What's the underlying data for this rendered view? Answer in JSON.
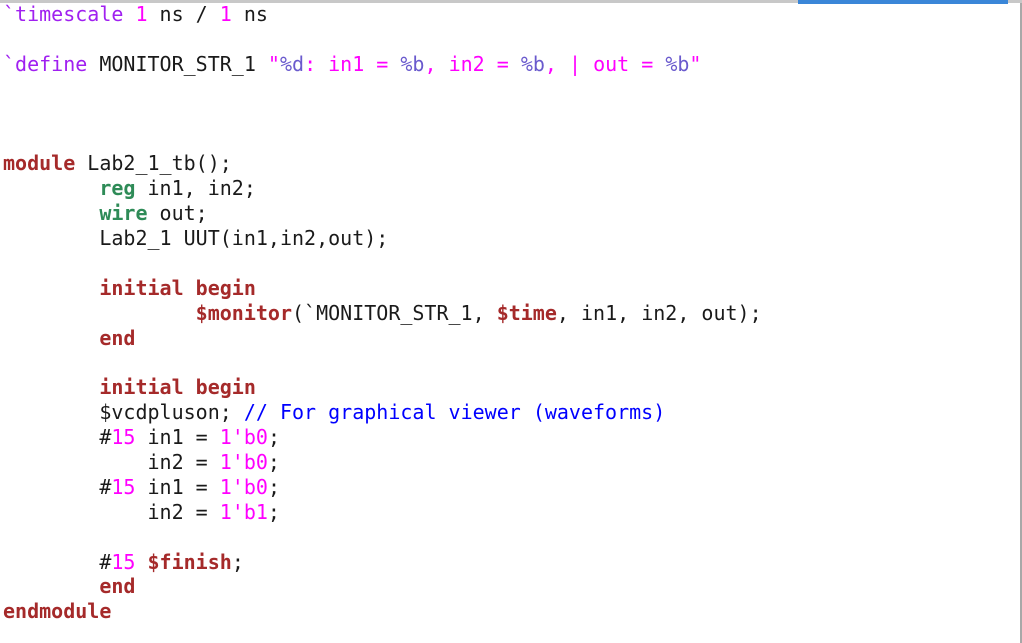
{
  "editor": {
    "language": "verilog",
    "lines": [
      [
        {
          "t": "`timescale",
          "c": "dir"
        },
        {
          "t": " ",
          "c": "plain"
        },
        {
          "t": "1",
          "c": "num"
        },
        {
          "t": " ns / ",
          "c": "plain"
        },
        {
          "t": "1",
          "c": "num"
        },
        {
          "t": " ns",
          "c": "plain"
        }
      ],
      [],
      [
        {
          "t": "`define",
          "c": "dir"
        },
        {
          "t": " MONITOR_STR_1 ",
          "c": "plain"
        },
        {
          "t": "\"",
          "c": "str"
        },
        {
          "t": "%d",
          "c": "fmt"
        },
        {
          "t": ": in1 = ",
          "c": "str"
        },
        {
          "t": "%b",
          "c": "fmt"
        },
        {
          "t": ", in2 = ",
          "c": "str"
        },
        {
          "t": "%b",
          "c": "fmt"
        },
        {
          "t": ", | out = ",
          "c": "str"
        },
        {
          "t": "%b",
          "c": "fmt"
        },
        {
          "t": "\"",
          "c": "str"
        }
      ],
      [],
      [],
      [],
      [
        {
          "t": "module",
          "c": "kw"
        },
        {
          "t": " Lab2_1_tb();",
          "c": "plain"
        }
      ],
      [
        {
          "t": "        ",
          "c": "plain"
        },
        {
          "t": "reg",
          "c": "type"
        },
        {
          "t": " in1, in2;",
          "c": "plain"
        }
      ],
      [
        {
          "t": "        ",
          "c": "plain"
        },
        {
          "t": "wire",
          "c": "type"
        },
        {
          "t": " out;",
          "c": "plain"
        }
      ],
      [
        {
          "t": "        Lab2_1 UUT(in1,in2,out);",
          "c": "plain"
        }
      ],
      [],
      [
        {
          "t": "        ",
          "c": "plain"
        },
        {
          "t": "initial",
          "c": "kw"
        },
        {
          "t": " ",
          "c": "plain"
        },
        {
          "t": "begin",
          "c": "kw"
        }
      ],
      [
        {
          "t": "                ",
          "c": "plain"
        },
        {
          "t": "$monitor",
          "c": "sys"
        },
        {
          "t": "(`MONITOR_STR_1, ",
          "c": "plain"
        },
        {
          "t": "$time",
          "c": "sys"
        },
        {
          "t": ", in1, in2, out);",
          "c": "plain"
        }
      ],
      [
        {
          "t": "        ",
          "c": "plain"
        },
        {
          "t": "end",
          "c": "kw"
        }
      ],
      [],
      [
        {
          "t": "        ",
          "c": "plain"
        },
        {
          "t": "initial",
          "c": "kw"
        },
        {
          "t": " ",
          "c": "plain"
        },
        {
          "t": "begin",
          "c": "kw"
        }
      ],
      [
        {
          "t": "        $vcdpluson; ",
          "c": "plain"
        },
        {
          "t": "// For graphical viewer (waveforms)",
          "c": "comment"
        }
      ],
      [
        {
          "t": "        #",
          "c": "plain"
        },
        {
          "t": "15",
          "c": "num"
        },
        {
          "t": " in1 = ",
          "c": "plain"
        },
        {
          "t": "1'b0",
          "c": "num"
        },
        {
          "t": ";",
          "c": "plain"
        }
      ],
      [
        {
          "t": "            in2 = ",
          "c": "plain"
        },
        {
          "t": "1'b0",
          "c": "num"
        },
        {
          "t": ";",
          "c": "plain"
        }
      ],
      [
        {
          "t": "        #",
          "c": "plain"
        },
        {
          "t": "15",
          "c": "num"
        },
        {
          "t": " in1 = ",
          "c": "plain"
        },
        {
          "t": "1'b0",
          "c": "num"
        },
        {
          "t": ";",
          "c": "plain"
        }
      ],
      [
        {
          "t": "            in2 = ",
          "c": "plain"
        },
        {
          "t": "1'b1",
          "c": "num"
        },
        {
          "t": ";",
          "c": "plain"
        }
      ],
      [],
      [
        {
          "t": "        #",
          "c": "plain"
        },
        {
          "t": "15",
          "c": "num"
        },
        {
          "t": " ",
          "c": "plain"
        },
        {
          "t": "$finish",
          "c": "sys"
        },
        {
          "t": ";",
          "c": "plain"
        }
      ],
      [
        {
          "t": "        ",
          "c": "plain"
        },
        {
          "t": "end",
          "c": "kw"
        }
      ],
      [
        {
          "t": "endmodule",
          "c": "kw"
        }
      ]
    ]
  },
  "colors": {
    "keyword": "#a52a2a",
    "type": "#2e8b57",
    "system_task": "#a52a2a",
    "number": "#ff00ff",
    "string": "#ff00ff",
    "format_specifier": "#6a5acd",
    "directive": "#a020f0",
    "comment": "#0000ff",
    "plain": "#1a1a1a",
    "accent_bar": "#3a86d8"
  }
}
